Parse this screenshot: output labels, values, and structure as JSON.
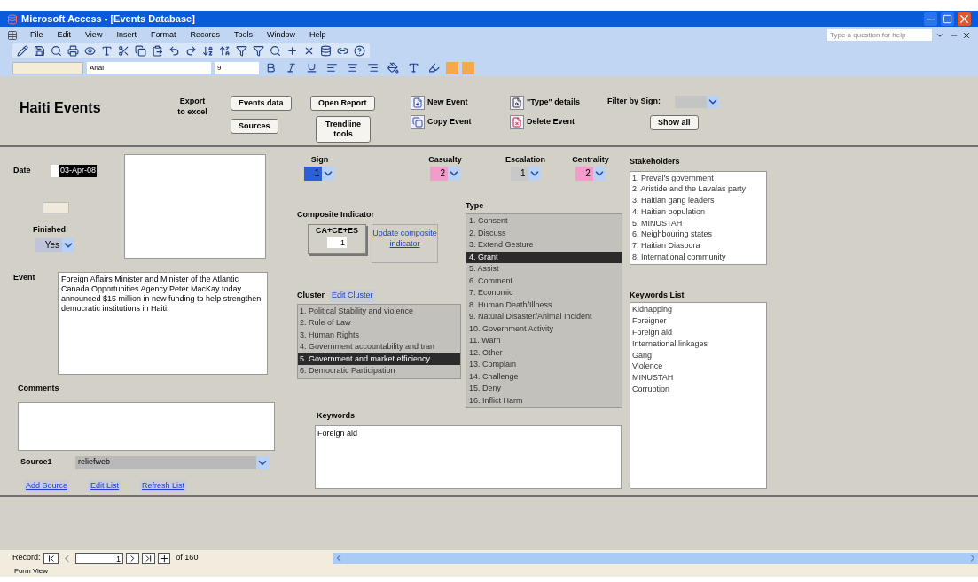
{
  "window": {
    "title": "Microsoft Access - [Events Database]"
  },
  "menu": [
    "File",
    "Edit",
    "View",
    "Insert",
    "Format",
    "Records",
    "Tools",
    "Window",
    "Help"
  ],
  "help_box": {
    "placeholder": "Type a question for help"
  },
  "format_toolbar": {
    "font": "Arial",
    "size": "9"
  },
  "header": {
    "title": "Haiti Events",
    "export_label": "Export to excel",
    "export_buttons": [
      "Events data",
      "Sources"
    ],
    "report_buttons": [
      "Open Report",
      "Trendline tools"
    ],
    "event_buttons": [
      {
        "kind": "new",
        "label": "New Event"
      },
      {
        "kind": "copy",
        "label": "Copy Event"
      }
    ],
    "detail_buttons": [
      {
        "kind": "details",
        "label": "\"Type\" details"
      },
      {
        "kind": "delete",
        "label": "Delete Event"
      }
    ],
    "filter_label": "Filter by Sign:",
    "show_all": "Show all"
  },
  "date": {
    "label": "Date",
    "value": "03-Apr-08"
  },
  "finished": {
    "label": "Finished",
    "value": "Yes"
  },
  "event": {
    "label": "Event",
    "value": "Foreign Affairs Minister and Minister of the Atlantic Canada Opportunities Agency Peter MacKay today announced $15 million in new funding to help strengthen democratic institutions in Haiti."
  },
  "comments": {
    "label": "Comments"
  },
  "source": {
    "label": "Source1",
    "value": "reliefweb"
  },
  "source_links": [
    "Add Source",
    "Edit List",
    "Refresh List"
  ],
  "indicators": [
    {
      "label": "Sign",
      "value": "1",
      "color": "#2d5fd6"
    },
    {
      "label": "Casualty",
      "value": "2",
      "color": "#f19ccb"
    },
    {
      "label": "Escalation",
      "value": "1",
      "color": "#c8c8c8"
    },
    {
      "label": "Centrality",
      "value": "2",
      "color": "#f19ccb"
    }
  ],
  "composite": {
    "label": "Composite Indicator",
    "formula": "CA+CE+ES",
    "value": "1",
    "update_link": "Update composite indicator"
  },
  "cluster": {
    "label": "Cluster",
    "edit": "Edit Cluster",
    "items": [
      {
        "label": "1. Political Stability and violence",
        "selected": false
      },
      {
        "label": "2. Rule of Law",
        "selected": false
      },
      {
        "label": "3. Human Rights",
        "selected": false
      },
      {
        "label": "4. Government accountability and tran",
        "selected": false
      },
      {
        "label": "5. Government and market efficiency",
        "selected": true
      },
      {
        "label": "6. Democratic Participation",
        "selected": false
      }
    ]
  },
  "type": {
    "label": "Type",
    "items": [
      {
        "label": "1. Consent",
        "selected": false
      },
      {
        "label": "2. Discuss",
        "selected": false
      },
      {
        "label": "3. Extend Gesture",
        "selected": false
      },
      {
        "label": "4. Grant",
        "selected": true
      },
      {
        "label": "5. Assist",
        "selected": false
      },
      {
        "label": "6. Comment",
        "selected": false
      },
      {
        "label": "7. Economic",
        "selected": false
      },
      {
        "label": "8. Human Death/Illness",
        "selected": false
      },
      {
        "label": "9. Natural Disaster/Animal Incident",
        "selected": false
      },
      {
        "label": "10. Government Activity",
        "selected": false
      },
      {
        "label": "11. Warn",
        "selected": false
      },
      {
        "label": "12. Other",
        "selected": false
      },
      {
        "label": "13. Complain",
        "selected": false
      },
      {
        "label": "14. Challenge",
        "selected": false
      },
      {
        "label": "15. Deny",
        "selected": false
      },
      {
        "label": "16. Inflict Harm",
        "selected": false
      }
    ]
  },
  "keywords": {
    "label": "Keywords",
    "value": "Foreign aid"
  },
  "stakeholders": {
    "label": "Stakeholders",
    "items": [
      "1. Preval's government",
      "2. Aristide and the Lavalas party",
      "3. Haitian gang leaders",
      "4. Haitian population",
      "5. MINUSTAH",
      "6. Neighbouring states",
      "7. Haitian Diaspora",
      "8. International community"
    ]
  },
  "keywords_list": {
    "label": "Keywords List",
    "items": [
      "Kidnapping",
      "Foreigner",
      "Foreign aid",
      "International linkages",
      "Gang",
      "Violence",
      "MINUSTAH",
      "Corruption"
    ]
  },
  "record_nav": {
    "label": "Record:",
    "current": "1",
    "total": "of 160"
  },
  "status_bar": "Form View"
}
